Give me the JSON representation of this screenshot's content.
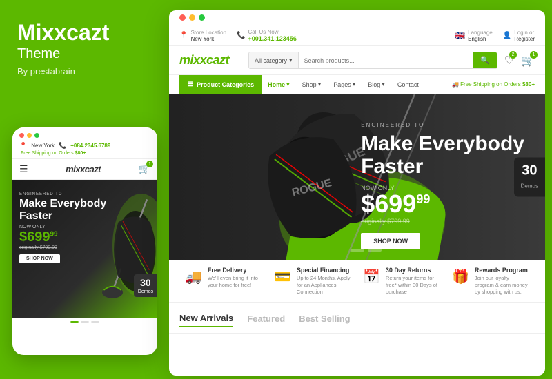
{
  "brand": {
    "name": "Mixxcazt",
    "theme_label": "Theme",
    "by": "By prestabrain"
  },
  "colors": {
    "primary": "#5cb800",
    "dark": "#222222",
    "white": "#ffffff"
  },
  "mobile": {
    "location_label": "New York",
    "phone": "+084.2345.6789",
    "shipping": "Free Shipping on Orders",
    "shipping_amount": "$80+",
    "brand": "mixxcazt",
    "cart_count": "1",
    "hero_engineered": "ENGINEERED TO",
    "hero_headline1": "Make Everybody",
    "hero_headline2": "Faster",
    "now_only": "NOW ONLY",
    "price_main": "$699",
    "price_cents": "99",
    "original_price": "originally $799.99",
    "shop_btn": "SHOP NOW",
    "demos_num": "30",
    "demos_label": "Demos"
  },
  "desktop": {
    "top_bar": {
      "store_label": "Store Location",
      "store_value": "New York",
      "call_label": "Call Us Now:",
      "phone": "+001.341.123456",
      "language_label": "Language",
      "language_value": "English",
      "login": "Login or",
      "register": "Register"
    },
    "header": {
      "logo": "mixxcazt",
      "search_category": "All category",
      "search_placeholder": "Search products...",
      "wishlist_count": "2",
      "cart_count": "1"
    },
    "nav": {
      "categories_btn": "Product Categories",
      "links": [
        "Home",
        "Shop",
        "Pages",
        "Blog",
        "Contact"
      ],
      "shipping": "Free Shipping on Orders",
      "shipping_amount": "$80+"
    },
    "hero": {
      "engineered": "ENGINEERED TO",
      "headline1": "Make Everybody",
      "headline2": "Faster",
      "now_only": "NOW ONLY",
      "price_main": "$699",
      "price_cents": "99",
      "original": "originally $799.99",
      "shop_btn": "SHOP NOW",
      "demos_num": "30",
      "demos_label": "Demos"
    },
    "features": [
      {
        "icon": "🚚",
        "title": "Free Delivery",
        "desc": "We'll even bring it into your home for free!"
      },
      {
        "icon": "💳",
        "title": "Special Financing",
        "desc": "Up to 24 Months. Apply for an Appliances Connection"
      },
      {
        "icon": "📅",
        "title": "30 Day Returns",
        "desc": "Return your items for free* within 30 Days of purchase"
      },
      {
        "icon": "🎁",
        "title": "Rewards Program",
        "desc": "Join our loyalty program & earn money by shopping with us."
      }
    ],
    "tabs": [
      "New Arrivals",
      "Featured",
      "Best Selling"
    ]
  }
}
